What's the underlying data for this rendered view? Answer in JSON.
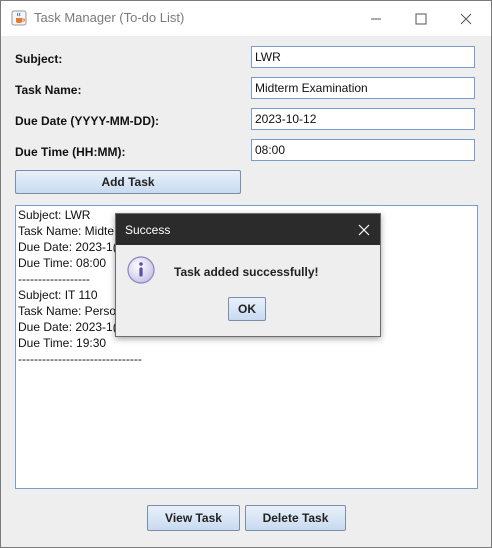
{
  "window": {
    "title": "Task Manager (To-do List)",
    "icons": {
      "app": "java-cup-icon",
      "minimize": "minimize-icon",
      "maximize": "maximize-icon",
      "close": "close-icon"
    }
  },
  "form": {
    "subject": {
      "label": "Subject:",
      "value": "LWR"
    },
    "task_name": {
      "label": "Task Name:",
      "value": "Midterm Examination"
    },
    "due_date": {
      "label": "Due Date (YYYY-MM-DD):",
      "value": "2023-10-12"
    },
    "due_time": {
      "label": "Due Time (HH:MM):",
      "value": "08:00"
    },
    "add_button": "Add Task"
  },
  "task_list": {
    "lines": [
      "Subject: LWR",
      "Task Name: Midte",
      "Due Date: 2023-1(",
      "Due Time: 08:00",
      "------------------",
      "Subject: IT 110",
      "Task Name: Perso",
      "Due Date: 2023-1(",
      "Due Time: 19:30",
      "-------------------------------"
    ]
  },
  "buttons": {
    "view": "View Task",
    "delete": "Delete Task"
  },
  "dialog": {
    "title": "Success",
    "message": "Task added successfully!",
    "ok": "OK",
    "icons": {
      "info": "info-icon",
      "close": "close-icon"
    }
  },
  "colors": {
    "dialog_titlebar": "#2b2b2b",
    "field_border": "#7a9cc9",
    "button_top": "#e9f1fb",
    "button_bottom": "#c8daf0"
  }
}
